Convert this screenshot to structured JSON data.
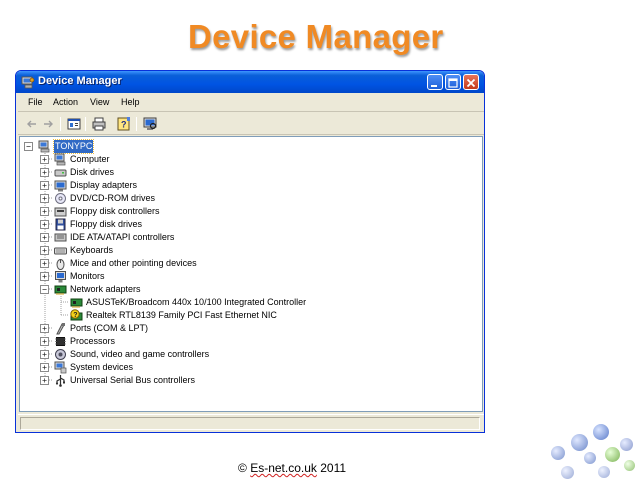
{
  "slide": {
    "title": "Device Manager",
    "footer_prefix": "© ",
    "footer_site": "Es-net.co.uk",
    "footer_suffix": " 2011"
  },
  "window": {
    "title": "Device Manager",
    "menu": [
      "File",
      "Action",
      "View",
      "Help"
    ]
  },
  "toolbar_icons": [
    "back-arrow-icon",
    "forward-arrow-icon",
    "properties-icon",
    "print-icon",
    "help-icon",
    "scan-hardware-icon"
  ],
  "tree": {
    "root": {
      "label": "TONYPC",
      "icon": "computer-icon",
      "selected": true
    },
    "categories": [
      {
        "label": "Computer",
        "icon": "computer-icon",
        "expanded": false
      },
      {
        "label": "Disk drives",
        "icon": "disk-drive-icon",
        "expanded": false
      },
      {
        "label": "Display adapters",
        "icon": "display-adapter-icon",
        "expanded": false
      },
      {
        "label": "DVD/CD-ROM drives",
        "icon": "cdrom-icon",
        "expanded": false
      },
      {
        "label": "Floppy disk controllers",
        "icon": "floppy-controller-icon",
        "expanded": false
      },
      {
        "label": "Floppy disk drives",
        "icon": "floppy-drive-icon",
        "expanded": false
      },
      {
        "label": "IDE ATA/ATAPI controllers",
        "icon": "ide-controller-icon",
        "expanded": false
      },
      {
        "label": "Keyboards",
        "icon": "keyboard-icon",
        "expanded": false
      },
      {
        "label": "Mice and other pointing devices",
        "icon": "mouse-icon",
        "expanded": false
      },
      {
        "label": "Monitors",
        "icon": "monitor-icon",
        "expanded": false
      },
      {
        "label": "Network adapters",
        "icon": "network-adapter-icon",
        "expanded": true,
        "children": [
          {
            "label": "ASUSTeK/Broadcom 440x 10/100 Integrated Controller",
            "icon": "network-card-icon"
          },
          {
            "label": "Realtek RTL8139 Family PCI Fast Ethernet NIC",
            "icon": "warning-device-icon"
          }
        ]
      },
      {
        "label": "Ports (COM & LPT)",
        "icon": "port-icon",
        "expanded": false
      },
      {
        "label": "Processors",
        "icon": "processor-icon",
        "expanded": false
      },
      {
        "label": "Sound, video and game controllers",
        "icon": "sound-icon",
        "expanded": false
      },
      {
        "label": "System devices",
        "icon": "system-device-icon",
        "expanded": false
      },
      {
        "label": "Universal Serial Bus controllers",
        "icon": "usb-icon",
        "expanded": false
      }
    ]
  },
  "colors": {
    "title_orange": "#f08a24",
    "xp_titlebar_blue": "#0054e3",
    "selection_blue": "#316ac5",
    "warning_yellow": "#f5d21a"
  }
}
